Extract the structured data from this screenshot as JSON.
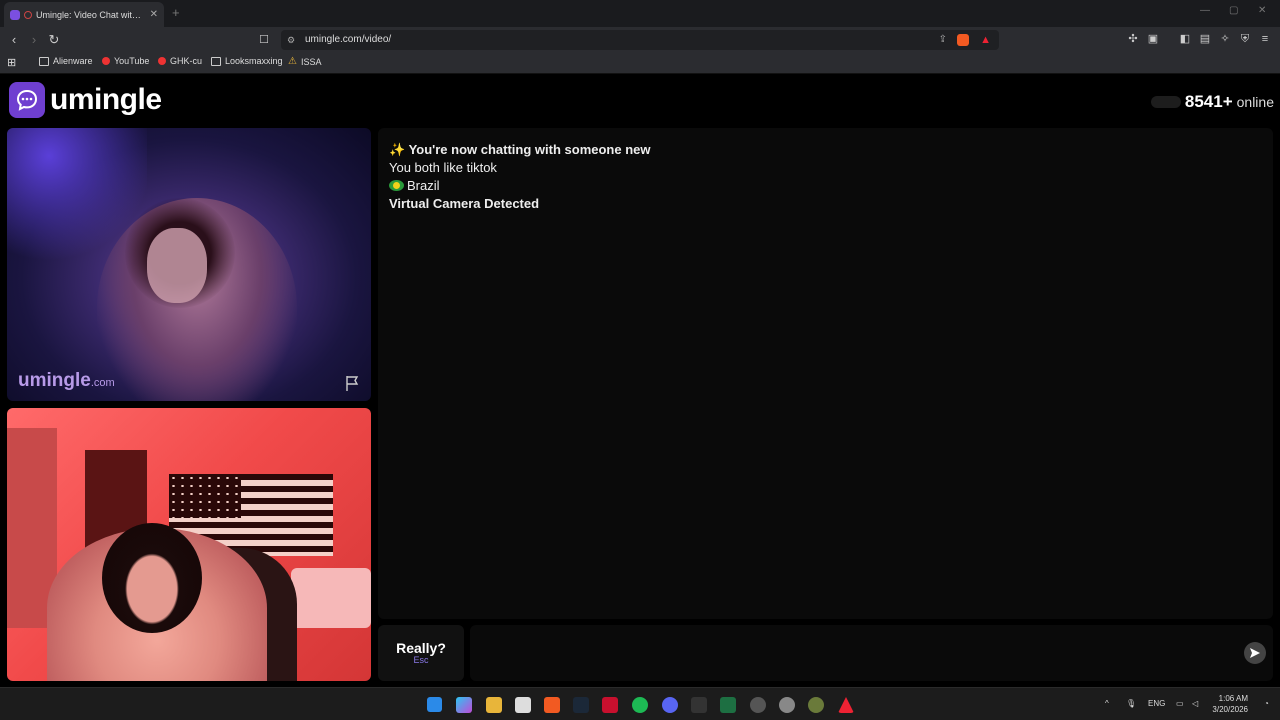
{
  "browser": {
    "tab_title": "Umingle: Video Chat with Str",
    "url": "umingle.com/video/",
    "bookmarks": [
      "Alienware",
      "YouTube",
      "GHK-cu",
      "Looksmaxxing",
      "ISSA"
    ]
  },
  "site": {
    "logo_text": "umingle",
    "online_count": "8541+",
    "online_label": "online",
    "watermark_main": "umingle",
    "watermark_suffix": ".com"
  },
  "chat": {
    "messages": [
      "✨ You're now chatting with someone new",
      "You both like tiktok",
      "Brazil",
      "Virtual Camera Detected"
    ],
    "skip_label": "Really?",
    "skip_key": "Esc"
  },
  "taskbar": {
    "language": "ENG",
    "time": "1:06 AM",
    "date": "3/20/2026"
  },
  "colors": {
    "accent": "#6f3fd0",
    "watermark": "#b79ae8",
    "skip_key": "#8a79e8"
  }
}
